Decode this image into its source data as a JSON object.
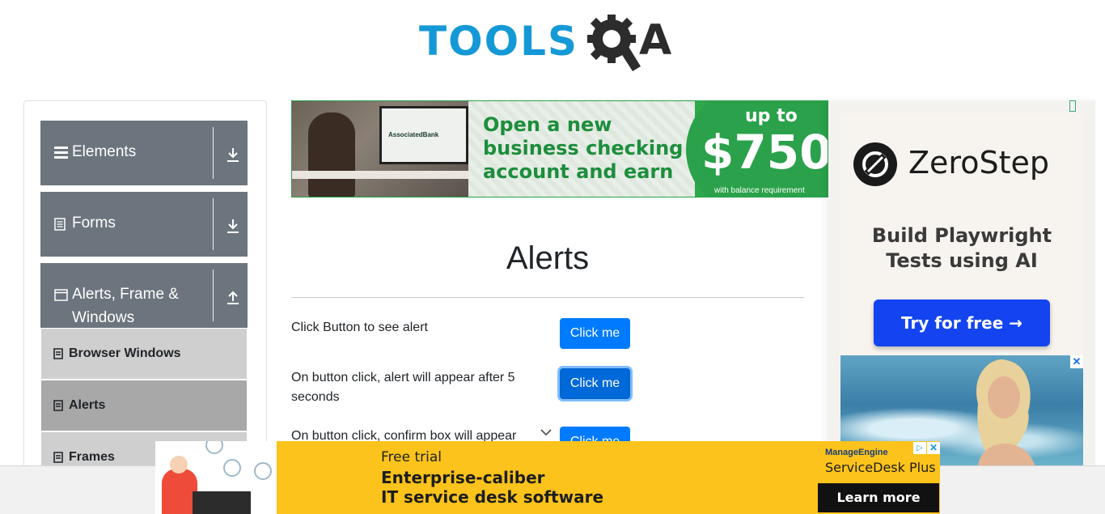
{
  "header": {
    "logo_text_tools": "TOOLS",
    "logo_text_a": "A"
  },
  "sidebar": {
    "groups": [
      {
        "label": "Elements",
        "icon": "hamburger-icon",
        "expanded": false
      },
      {
        "label": "Forms",
        "icon": "document-icon",
        "expanded": false
      },
      {
        "label": "Alerts, Frame &",
        "label_line2": "Windows",
        "icon": "window-icon",
        "expanded": true
      }
    ],
    "items": [
      {
        "label": "Browser Windows",
        "active": false
      },
      {
        "label": "Alerts",
        "active": true
      },
      {
        "label": "Frames",
        "active": false
      }
    ]
  },
  "top_ad": {
    "bank_name": "AssociatedBank",
    "headline": "Open a new business checking account and earn",
    "upto": "up to",
    "amount": "$750",
    "fine_print": "with balance requirement"
  },
  "main": {
    "title": "Alerts",
    "rows": [
      {
        "label": "Click Button to see alert",
        "button": "Click me"
      },
      {
        "label": "On button click, alert will appear after 5 seconds",
        "button": "Click me"
      },
      {
        "label": "On button click, confirm box will appear",
        "button": "Click me"
      }
    ]
  },
  "right_ad": {
    "brand": "ZeroStep",
    "tagline": "Build Playwright Tests using AI",
    "cta": "Try for free →",
    "close": "✕"
  },
  "bottom_ad": {
    "small_text": "Free trial",
    "line1": "Enterprise-caliber",
    "line2": "IT service desk software",
    "vendor": "ManageEngine",
    "product": "ServiceDesk Plus",
    "cta": "Learn more",
    "adchoices": "▷",
    "close": "✕"
  },
  "colors": {
    "sidebar_group": "#6c757d",
    "button_primary": "#007bff",
    "logo_blue": "#1599d6",
    "ad_yellow": "#fbc31b",
    "cta_blue": "#1344f0"
  }
}
